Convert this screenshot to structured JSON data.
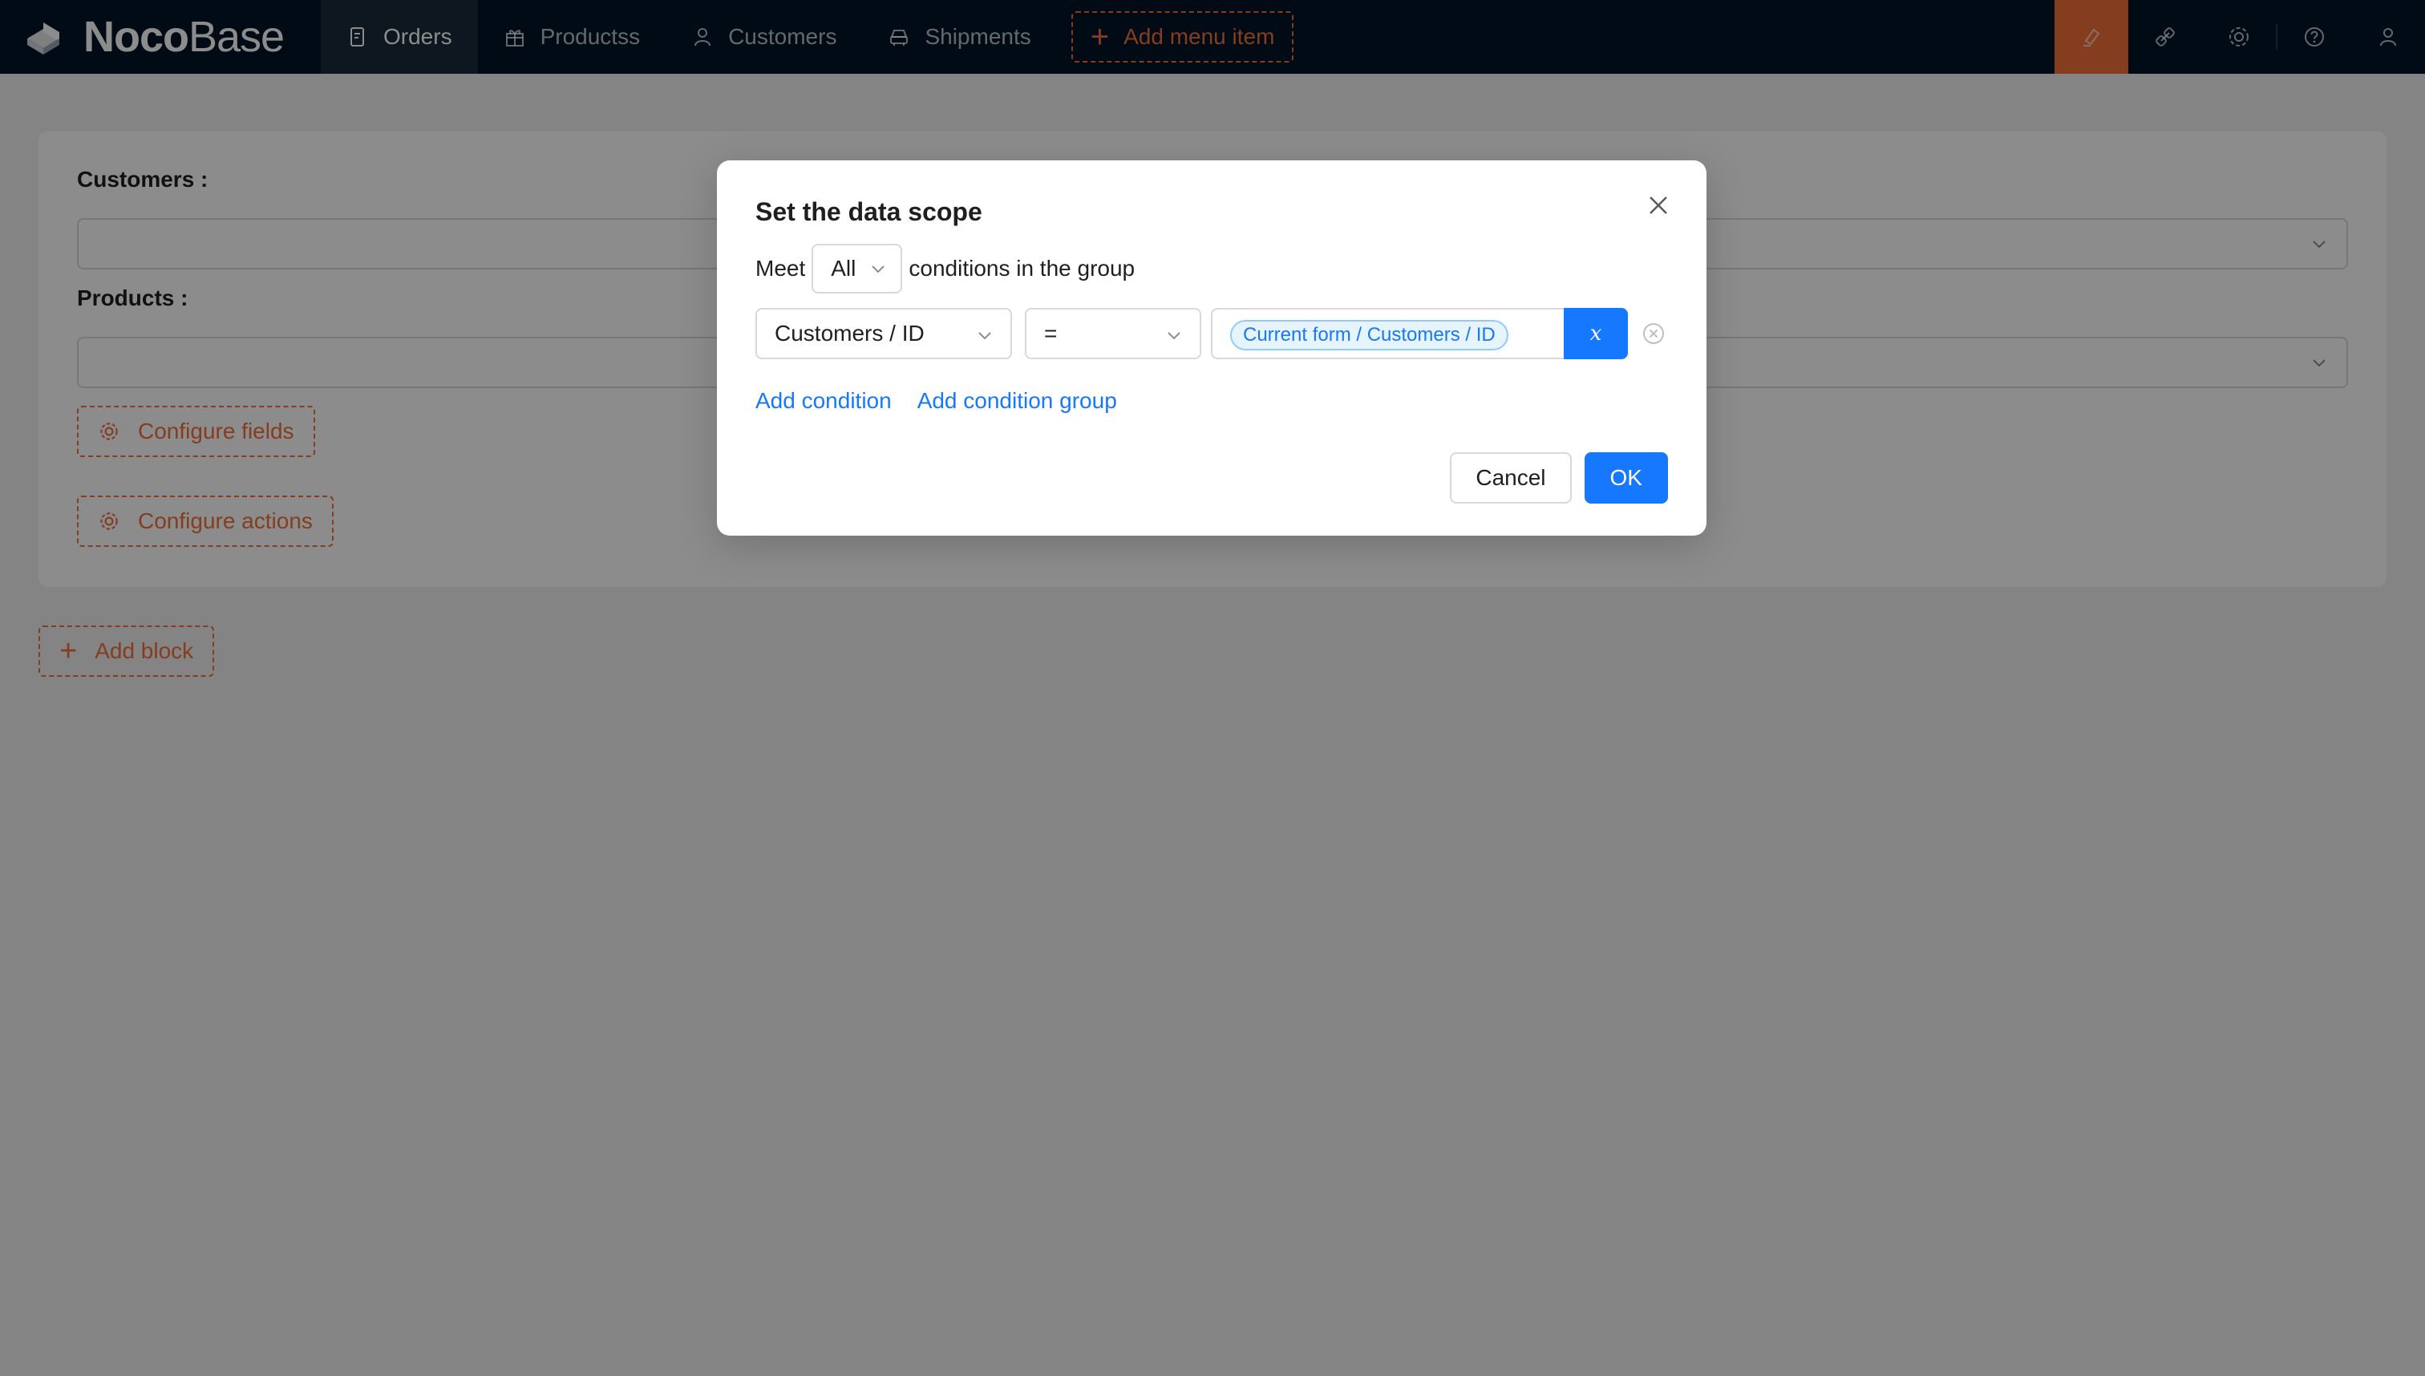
{
  "app": {
    "logo_bold": "Noco",
    "logo_light": "Base"
  },
  "nav": {
    "items": [
      {
        "label": "Orders",
        "icon": "file-icon",
        "active": true
      },
      {
        "label": "Productss",
        "icon": "gift-icon",
        "active": false
      },
      {
        "label": "Customers",
        "icon": "user-icon",
        "active": false
      },
      {
        "label": "Shipments",
        "icon": "car-icon",
        "active": false
      }
    ],
    "add_menu_item": "Add menu item",
    "tools": [
      "highlighter-icon",
      "plugin-icon",
      "settings-icon",
      "help-icon",
      "user-icon"
    ],
    "accent_color": "#f0703a"
  },
  "form": {
    "fields": [
      {
        "label": "Customers",
        "value": ""
      },
      {
        "label": "Products",
        "value": ""
      }
    ],
    "configure_fields": "Configure fields",
    "configure_actions": "Configure actions"
  },
  "add_block": "Add block",
  "modal": {
    "title": "Set the data scope",
    "meet_prefix": "Meet",
    "meet_value": "All",
    "meet_suffix": "conditions in the group",
    "condition": {
      "field": "Customers / ID",
      "operator": "=",
      "value_tag": "Current form / Customers / ID",
      "variable_button": "x"
    },
    "add_condition": "Add condition",
    "add_condition_group": "Add condition group",
    "cancel": "Cancel",
    "ok": "OK",
    "primary_color": "#1677ff"
  }
}
